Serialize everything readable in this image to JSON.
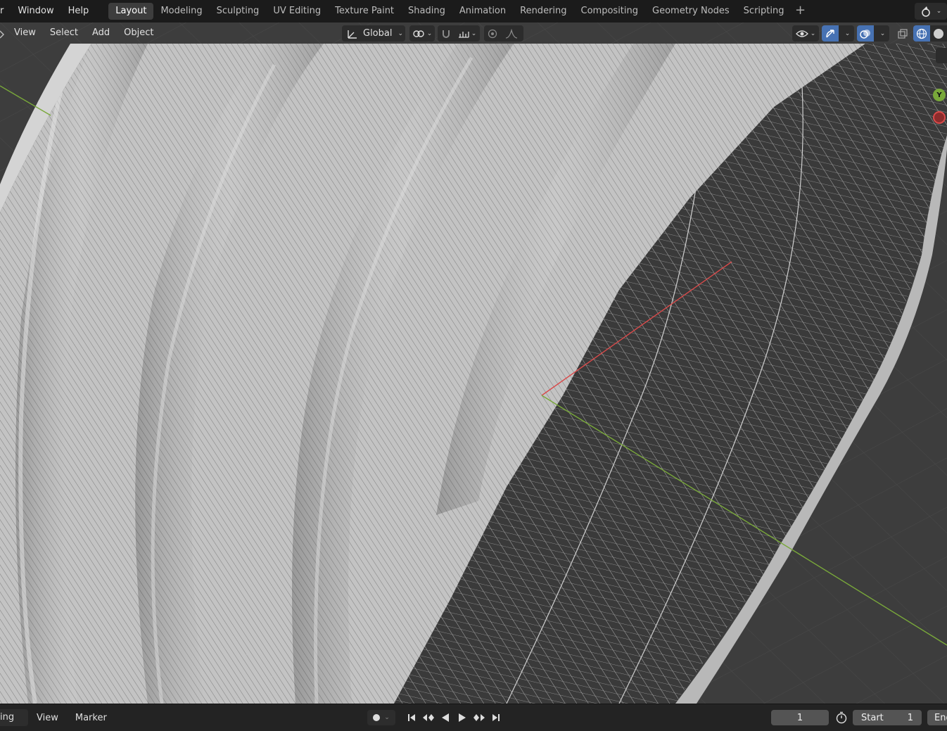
{
  "topbar": {
    "menus": [
      "r",
      "Window",
      "Help"
    ],
    "workspaces": [
      "Layout",
      "Modeling",
      "Sculpting",
      "UV Editing",
      "Texture Paint",
      "Shading",
      "Animation",
      "Rendering",
      "Compositing",
      "Geometry Nodes",
      "Scripting"
    ],
    "active_workspace": "Layout",
    "add_label": "+"
  },
  "viewport": {
    "menus": [
      "View",
      "Select",
      "Add",
      "Object"
    ],
    "transform_orientation": "Global",
    "gizmo_axes": {
      "y": "Y"
    },
    "colors": {
      "x_axis": "#d94a4a",
      "y_axis": "#79a83a",
      "accent": "#4772b3",
      "mesh": "#bcbcbc",
      "floor": "#3d3d3d"
    }
  },
  "timeline": {
    "mode_label": "ing",
    "menus": [
      "View",
      "Marker"
    ],
    "current_frame": "1",
    "start_label": "Start",
    "start_value": "1",
    "end_label": "End"
  }
}
